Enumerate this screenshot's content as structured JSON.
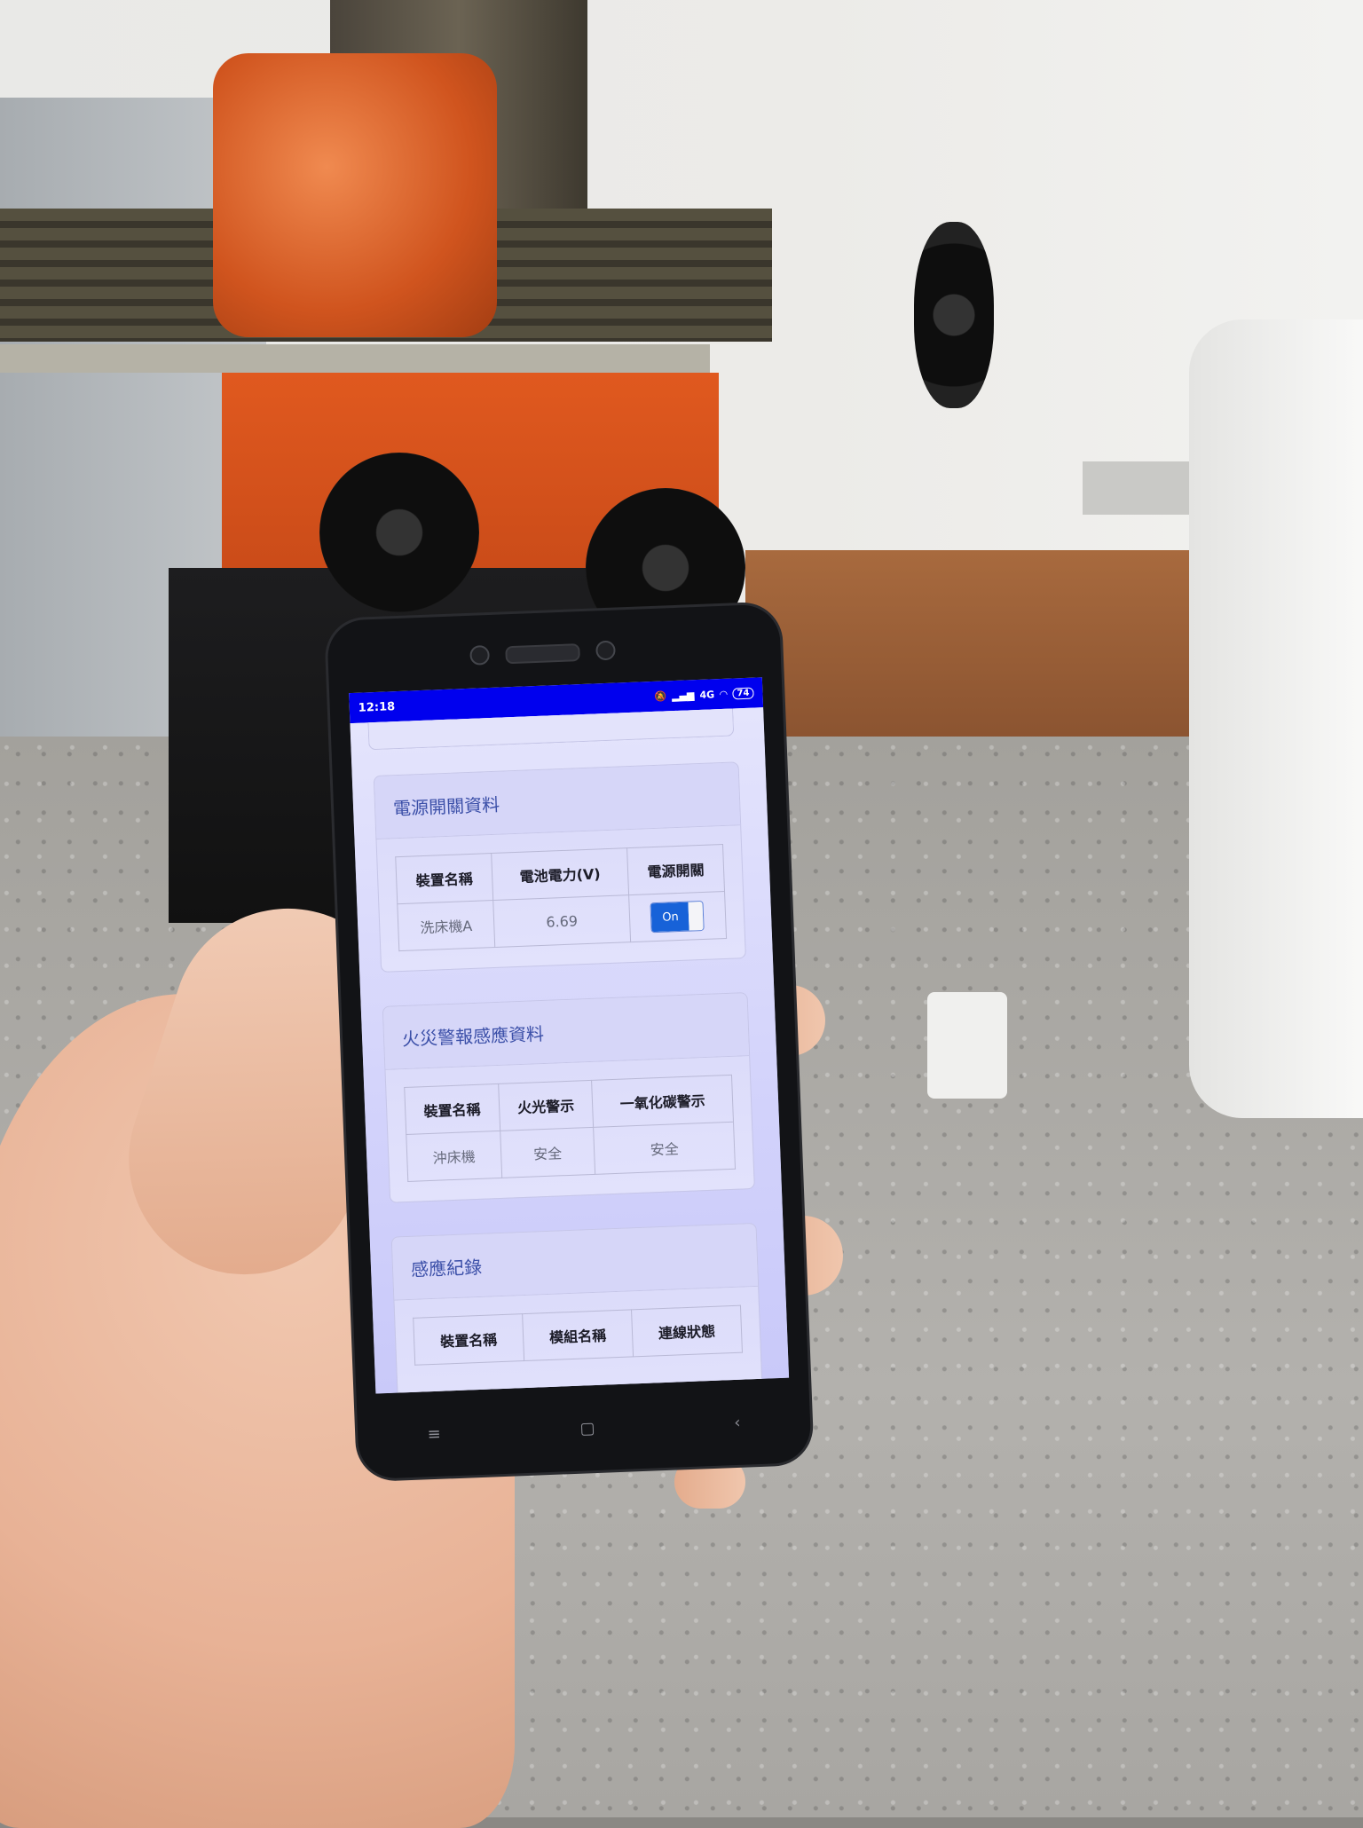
{
  "status_bar": {
    "time": "12:18",
    "network": "4G",
    "battery": "74",
    "icons": [
      "mute-bell-icon",
      "signal-icon",
      "wifi-icon",
      "battery-icon"
    ]
  },
  "power_card": {
    "title": "電源開關資料",
    "headers": [
      "裝置名稱",
      "電池電力(V)",
      "電源開關"
    ],
    "rows": [
      {
        "device": "洗床機A",
        "voltage": "6.69",
        "switch": "On"
      }
    ]
  },
  "fire_card": {
    "title": "火災警報感應資料",
    "headers": [
      "裝置名稱",
      "火光警示",
      "一氧化碳警示"
    ],
    "rows": [
      {
        "device": "沖床機",
        "flame": "安全",
        "co": "安全"
      }
    ]
  },
  "log_card": {
    "title": "感應紀錄",
    "headers": [
      "裝置名稱",
      "模組名稱",
      "連線狀態"
    ]
  },
  "nav": {
    "menu": "≡",
    "home": "▢",
    "back": "‹"
  },
  "colors": {
    "status_bar": "#0000ee",
    "card_title": "#3b4fa8",
    "toggle_on": "#1762d8"
  }
}
